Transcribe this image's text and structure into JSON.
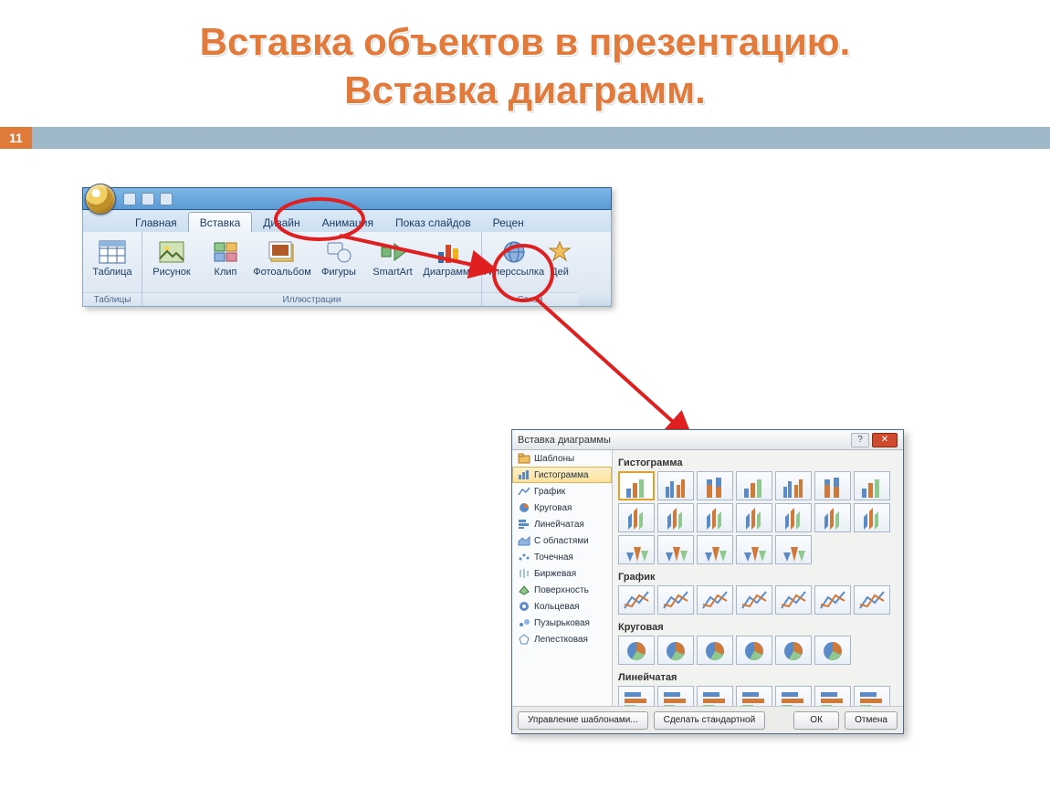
{
  "slide": {
    "title_line1": "Вставка объектов в презентацию.",
    "title_line2": "Вставка диаграмм.",
    "page_number": "11"
  },
  "ribbon": {
    "tabs": [
      "Главная",
      "Вставка",
      "Дизайн",
      "Анимация",
      "Показ слайдов",
      "Рецен"
    ],
    "active_tab_index": 1,
    "groups": {
      "tables": {
        "label": "Таблицы",
        "buttons": [
          {
            "label": "Таблица",
            "icon": "table-icon"
          }
        ]
      },
      "illustrations": {
        "label": "Иллюстрации",
        "buttons": [
          {
            "label": "Рисунок",
            "icon": "picture-icon"
          },
          {
            "label": "Клип",
            "icon": "clip-icon"
          },
          {
            "label": "Фотоальбом",
            "icon": "photoalbum-icon"
          },
          {
            "label": "Фигуры",
            "icon": "shapes-icon"
          },
          {
            "label": "SmartArt",
            "icon": "smartart-icon"
          },
          {
            "label": "Диаграмма",
            "icon": "chart-icon"
          }
        ]
      },
      "links": {
        "label": "Связи",
        "buttons": [
          {
            "label": "Гиперссылка",
            "icon": "hyperlink-icon"
          },
          {
            "label": "Дей",
            "icon": "action-icon"
          }
        ]
      }
    }
  },
  "dialog": {
    "title": "Вставка диаграммы",
    "sidebar": [
      {
        "label": "Шаблоны",
        "icon": "folder-icon"
      },
      {
        "label": "Гистограмма",
        "icon": "bar-icon"
      },
      {
        "label": "График",
        "icon": "line-icon"
      },
      {
        "label": "Круговая",
        "icon": "pie-icon"
      },
      {
        "label": "Линейчатая",
        "icon": "hbar-icon"
      },
      {
        "label": "С областями",
        "icon": "area-icon"
      },
      {
        "label": "Точечная",
        "icon": "scatter-icon"
      },
      {
        "label": "Биржевая",
        "icon": "stock-icon"
      },
      {
        "label": "Поверхность",
        "icon": "surface-icon"
      },
      {
        "label": "Кольцевая",
        "icon": "doughnut-icon"
      },
      {
        "label": "Пузырьковая",
        "icon": "bubble-icon"
      },
      {
        "label": "Лепестковая",
        "icon": "radar-icon"
      }
    ],
    "sidebar_selected_index": 1,
    "categories": [
      {
        "label": "Гистограмма",
        "thumb_count": 19,
        "selected_index": 0
      },
      {
        "label": "График",
        "thumb_count": 7
      },
      {
        "label": "Круговая",
        "thumb_count": 6
      },
      {
        "label": "Линейчатая",
        "thumb_count": 7
      }
    ],
    "footer": {
      "templates_btn": "Управление шаблонами...",
      "default_btn": "Сделать стандартной",
      "ok_btn": "ОК",
      "cancel_btn": "Отмена"
    }
  }
}
